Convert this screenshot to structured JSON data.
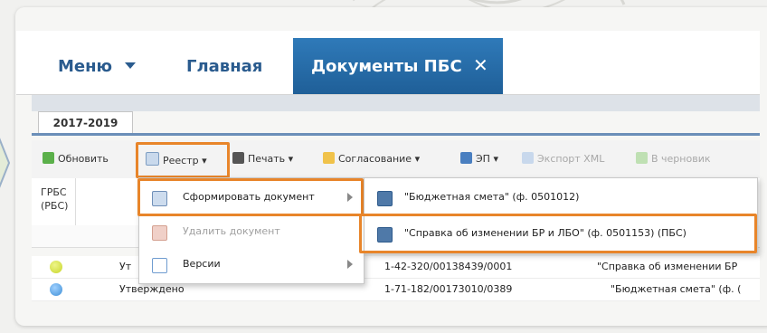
{
  "nav": {
    "menu": "Меню",
    "main": "Главная",
    "active_tab": "Документы ПБС",
    "close_glyph": "✕"
  },
  "period_tab": "2017-2019",
  "toolbar": {
    "refresh": "Обновить",
    "registry": "Реестр",
    "print": "Печать",
    "approval": "Согласование",
    "ep": "ЭП",
    "export_xml": "Экспорт XML",
    "to_draft": "В черновик"
  },
  "grid": {
    "col_grbs_line1": "ГРБС",
    "col_grbs_line2": "(РБС)",
    "rows": [
      {
        "status": "Ут",
        "number": "1-42-320/00138439/0001",
        "doc": "\"Справка об изменении БР",
        "dot_color": "#c8d62a"
      },
      {
        "status": "Утверждено",
        "number": "1-71-182/00173010/0389",
        "doc": "\"Бюджетная смета\" (ф. (",
        "dot_color": "#3f8fd6"
      }
    ]
  },
  "registry_menu": {
    "items": [
      {
        "label": "Сформировать документ",
        "disabled": false,
        "icon": "form-document-icon"
      },
      {
        "label": "Удалить документ",
        "disabled": true,
        "icon": "delete-document-icon"
      },
      {
        "label": "Версии",
        "disabled": false,
        "icon": "versions-icon"
      }
    ]
  },
  "form_submenu": {
    "items": [
      {
        "label": "\"Бюджетная смета\" (ф. 0501012)",
        "icon": "document-icon"
      },
      {
        "label": "\"Справка об изменении БР и ЛБО\" (ф. 0501153) (ПБС)",
        "icon": "document-icon"
      }
    ]
  },
  "colors": {
    "accent": "#2a5b8e",
    "active_tab": "#2670ad",
    "highlight": "#e8852a"
  }
}
